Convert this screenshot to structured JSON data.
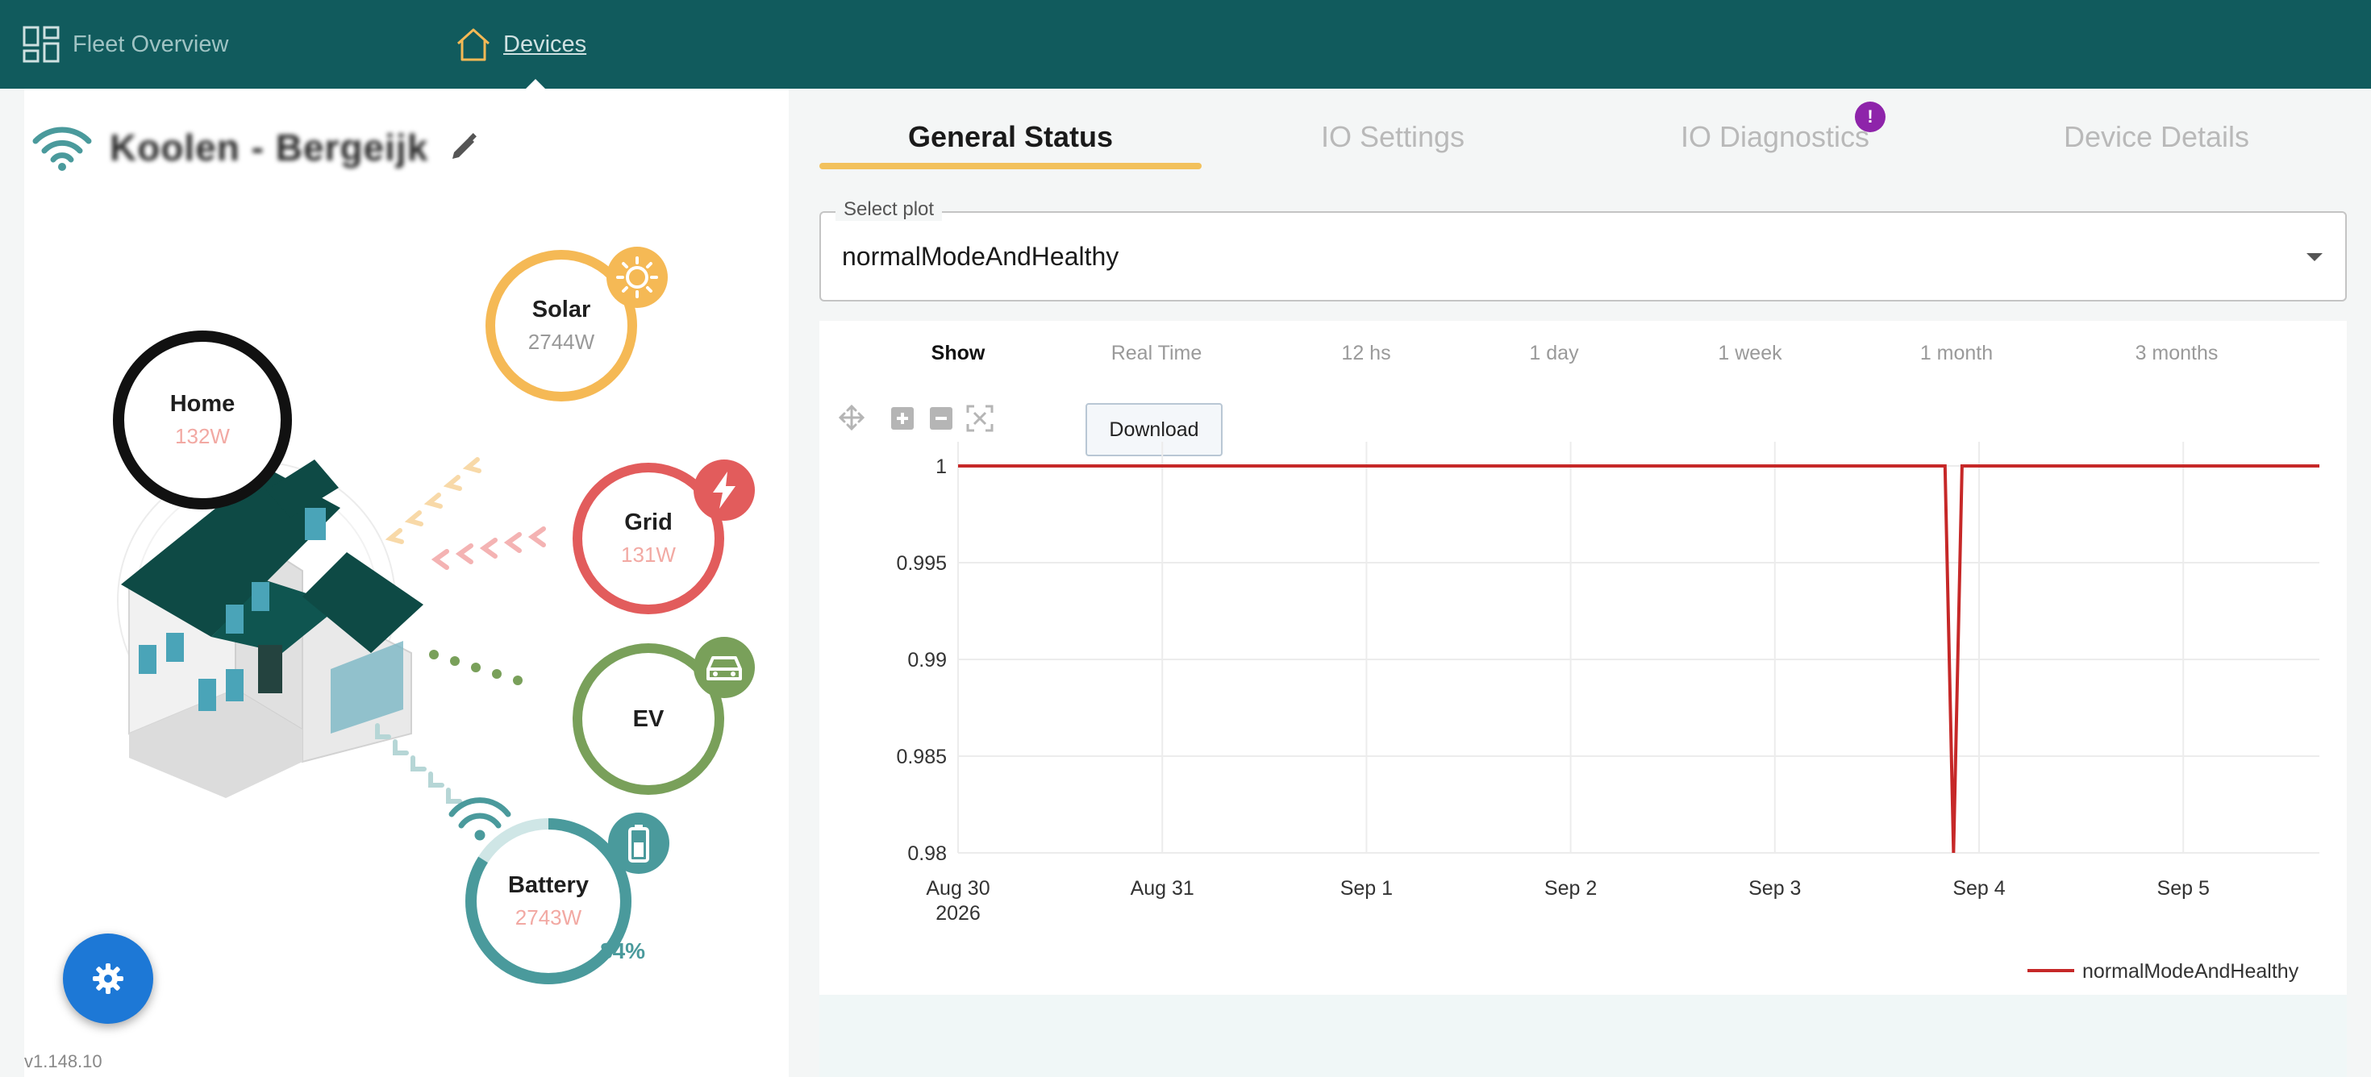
{
  "nav": {
    "fleet_overview": "Fleet Overview",
    "devices": "Devices",
    "fleet_icon": "grid-icon",
    "devices_icon": "home-icon"
  },
  "device": {
    "name": "Koolen - Bergeijk",
    "connection_icon": "wifi-icon",
    "edit_icon": "pencil-icon"
  },
  "energy_flow": {
    "home": {
      "label": "Home",
      "value": "132W",
      "color": "#111111",
      "value_color": "#f2a9a3"
    },
    "solar": {
      "label": "Solar",
      "value": "2744W",
      "color": "#f5b955",
      "icon": "sun-icon"
    },
    "grid": {
      "label": "Grid",
      "value": "131W",
      "color": "#e25c5c",
      "icon": "lightning-icon",
      "value_color": "#f2a9a3"
    },
    "ev": {
      "label": "EV",
      "value": "",
      "color": "#79a05a",
      "icon": "car-icon"
    },
    "battery": {
      "label": "Battery",
      "value": "2743W",
      "color": "#4a9a9c",
      "icon": "battery-icon",
      "percent": "84%",
      "level": 0.84,
      "value_color": "#f2a9a3"
    }
  },
  "settings_icon": "gear-icon",
  "version": "v1.148.10",
  "tabs": [
    {
      "label": "General Status",
      "active": true
    },
    {
      "label": "IO Settings",
      "active": false
    },
    {
      "label": "IO Diagnostics",
      "active": false,
      "alert": "!"
    },
    {
      "label": "Device Details",
      "active": false
    }
  ],
  "plot_select": {
    "legend": "Select plot",
    "value": "normalModeAndHealthy"
  },
  "ranges": {
    "show": "Show",
    "options": [
      "Real Time",
      "12 hs",
      "1 day",
      "1 week",
      "1 month",
      "3 months"
    ]
  },
  "toolbar": {
    "pan_icon": "move-icon",
    "zoom_in_icon": "plus-icon",
    "zoom_out_icon": "minus-icon",
    "reset_icon": "fit-icon",
    "download": "Download"
  },
  "chart_data": {
    "type": "line",
    "title": "",
    "xlabel": "",
    "ylabel": "",
    "x_ticks": [
      "Aug 30\n2026",
      "Aug 31",
      "Sep 1",
      "Sep 2",
      "Sep 3",
      "Sep 4",
      "Sep 5"
    ],
    "y_ticks": [
      "1",
      "0.995",
      "0.99",
      "0.985",
      "0.98"
    ],
    "ylim": [
      0.98,
      1
    ],
    "xlim": [
      "2026-08-30",
      "2026-09-05 16:00"
    ],
    "grid": true,
    "legend": "bottom-right",
    "series": [
      {
        "name": "normalModeAndHealthy",
        "color": "#c62828",
        "x": [
          "2026-08-30 00:00",
          "2026-09-03 20:00",
          "2026-09-03 21:00",
          "2026-09-03 22:00",
          "2026-09-05 16:00"
        ],
        "y": [
          1,
          1,
          0.98,
          1,
          1
        ]
      }
    ]
  }
}
